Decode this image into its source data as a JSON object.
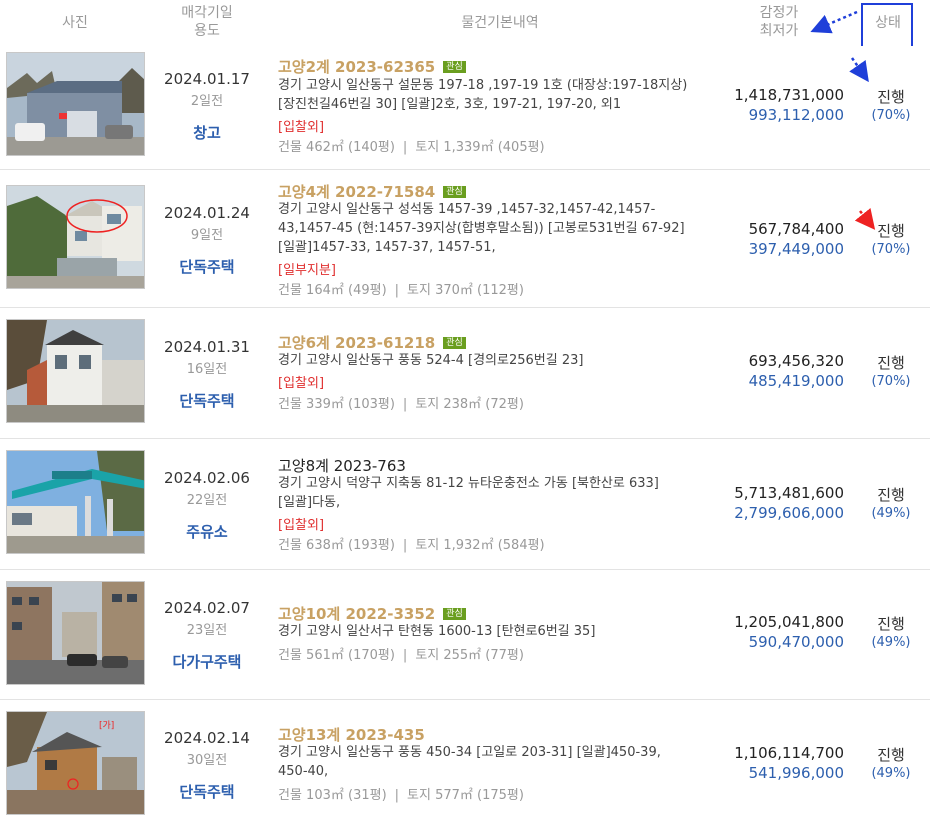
{
  "header": {
    "photo": "사진",
    "date_use_1": "매각기일",
    "date_use_2": "용도",
    "basic": "물건기본내역",
    "appraisal_1": "감정가",
    "appraisal_2": "최저가",
    "status": "상태"
  },
  "interest_badge": "관심",
  "colors": {
    "accent": "#c8a163",
    "blue": "#2d5fae",
    "badge": "#6a9e1f",
    "red": "#e03030",
    "highlight_box": "#1f3fd9"
  },
  "rows": [
    {
      "date": "2024.01.17",
      "days": "2일전",
      "use": "창고",
      "case": "고양2계 2023-62365",
      "badge": true,
      "addr1": "경기 고양시 일산동구 설문동 197-18 ,197-19 1호 (대장상:197-18지상)",
      "addr2": "[장진천길46번길 30]  [일괄]2호, 3호, 197-21, 197-20, 외1",
      "addr3": "",
      "tag": "[입찰외]",
      "building": "건물 462㎡ (140평)",
      "land": "토지 1,339㎡ (405평)",
      "appraisal": "1,418,731,000",
      "min": "993,112,000",
      "status": "진행",
      "pct": "(70%)"
    },
    {
      "date": "2024.01.24",
      "days": "9일전",
      "use": "단독주택",
      "case": "고양4계 2022-71584",
      "badge": true,
      "addr1": "경기 고양시 일산동구 성석동 1457-39 ,1457-32,1457-42,1457-",
      "addr2": "43,1457-45 (현:1457-39지상(합병후말소됨)) [고봉로531번길 67-92]",
      "addr3": " [일괄]1457-33, 1457-37, 1457-51,",
      "tag": "[일부지분]",
      "building": "건물 164㎡ (49평)",
      "land": "토지 370㎡ (112평)",
      "appraisal": "567,784,400",
      "min": "397,449,000",
      "status": "진행",
      "pct": "(70%)"
    },
    {
      "date": "2024.01.31",
      "days": "16일전",
      "use": "단독주택",
      "case": "고양6계 2023-61218",
      "badge": true,
      "addr1": "경기 고양시 일산동구 풍동 524-4 [경의로256번길 23]",
      "addr2": "",
      "addr3": "",
      "tag": "[입찰외]",
      "building": "건물 339㎡ (103평)",
      "land": "토지 238㎡ (72평)",
      "appraisal": "693,456,320",
      "min": "485,419,000",
      "status": "진행",
      "pct": "(70%)"
    },
    {
      "date": "2024.02.06",
      "days": "22일전",
      "use": "주유소",
      "case": "고양8계 2023-763",
      "badge": false,
      "addr1": "경기 고양시 덕양구 지축동 81-12 뉴타운충전소 가동 [북한산로 633]",
      "addr2": " [일괄]다동,",
      "addr3": "",
      "tag": "[입찰외]",
      "building": "건물 638㎡ (193평)",
      "land": "토지 1,932㎡ (584평)",
      "appraisal": "5,713,481,600",
      "min": "2,799,606,000",
      "status": "진행",
      "pct": "(49%)"
    },
    {
      "date": "2024.02.07",
      "days": "23일전",
      "use": "다가구주택",
      "case": "고양10계 2022-3352",
      "badge": true,
      "addr1": "경기 고양시 일산서구 탄현동 1600-13 [탄현로6번길 35]",
      "addr2": "",
      "addr3": "",
      "tag": "",
      "building": "건물 561㎡ (170평)",
      "land": "토지 255㎡ (77평)",
      "appraisal": "1,205,041,800",
      "min": "590,470,000",
      "status": "진행",
      "pct": "(49%)"
    },
    {
      "date": "2024.02.14",
      "days": "30일전",
      "use": "단독주택",
      "case": "고양13계 2023-435",
      "badge": false,
      "addr1": "경기 고양시 일산동구 풍동 450-34 [고일로 203-31]  [일괄]450-39,",
      "addr2": "450-40,",
      "addr3": "",
      "tag": "",
      "building": "건물 103㎡ (31평)",
      "land": "토지 577㎡ (175평)",
      "appraisal": "1,106,114,700",
      "min": "541,996,000",
      "status": "진행",
      "pct": "(49%)"
    }
  ]
}
